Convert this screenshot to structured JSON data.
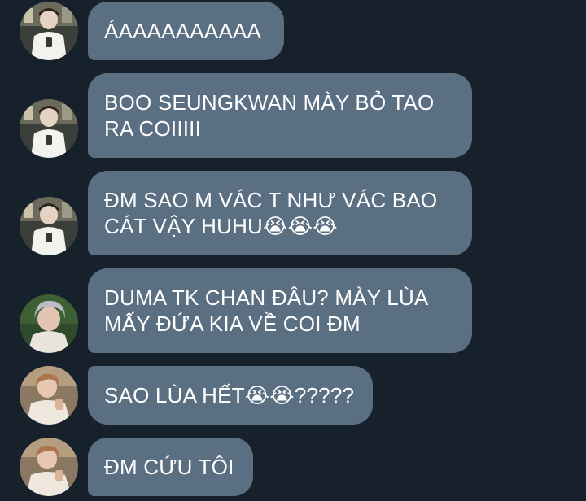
{
  "chat": {
    "background": "#17212b",
    "bubble_color": "#5b6f82",
    "messages": [
      {
        "text": "ÁAAAAAAAAAA",
        "avatar": "user-photo-avatar"
      },
      {
        "text": "BOO SEUNGKWAN MÀY BỎ TAO\nRA COIIIII",
        "avatar": "user-photo-avatar"
      },
      {
        "text": "ĐM SAO M VÁC T NHƯ VÁC BAO\nCÁT VẬY HUHU😭😭😭",
        "avatar": "user-photo-avatar"
      },
      {
        "text": "DUMA TK CHAN ĐÂU? MÀY LÙA\nMẤY ĐỨA KIA VỀ COI ĐM",
        "avatar": "silver-hair-avatar"
      },
      {
        "text": "SAO LÙA HẾT😭😭?????",
        "avatar": "smiling-boy-avatar"
      },
      {
        "text": "ĐM CỨU TÔI",
        "avatar": "smiling-boy-avatar"
      }
    ]
  }
}
